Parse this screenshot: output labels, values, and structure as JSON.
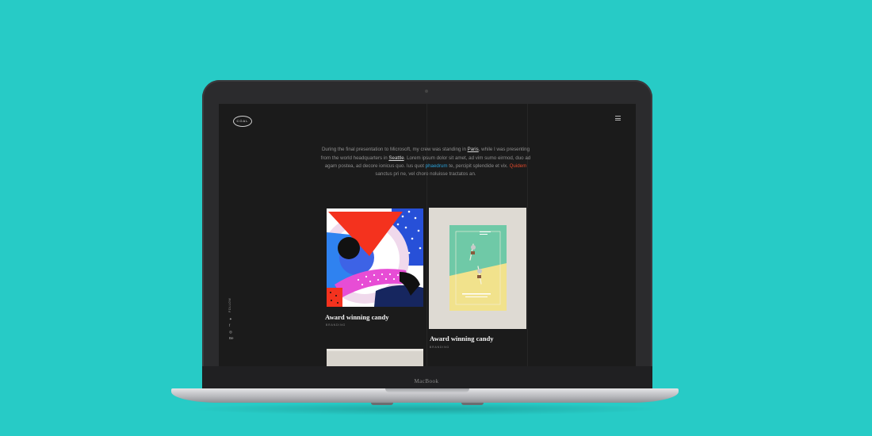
{
  "device": {
    "brand_label": "MacBook"
  },
  "site": {
    "logo_text": "COAL",
    "menu_icon": "hamburger-menu-icon"
  },
  "intro": {
    "part1": "During the final presentation to Microsoft, my crew was standing in ",
    "link1": "Paris",
    "part2": ", while I was presenting from the world headquarters in ",
    "link2": "Seattle",
    "part3": ". Lorem ipsum dolor sit amet, ad vim sumo eirmod, duo ad agam postea, ad decore ionicus quo. Ius quot ",
    "highlight1": "phaedrum",
    "part4": " te, percipit splendide et vix. ",
    "highlight2": "Quidem",
    "part5": " sanctus pri ne, vel choro noluisse tractatos an."
  },
  "social": {
    "follow_label": "FOLLOW",
    "icons": [
      "twitter-icon",
      "facebook-icon",
      "instagram-icon",
      "behance-icon"
    ],
    "glyphs": [
      "✦",
      "f",
      "◎",
      "Be"
    ]
  },
  "cards": [
    {
      "title": "Award winning candy",
      "tag": "BRANDING"
    },
    {
      "title": "Award winning candy",
      "tag": "BRANDING"
    }
  ],
  "colors": {
    "background": "#27cbc6",
    "screen_bg": "#1b1b1b",
    "link_blue": "#2a9fd6",
    "link_red": "#e0492b"
  }
}
